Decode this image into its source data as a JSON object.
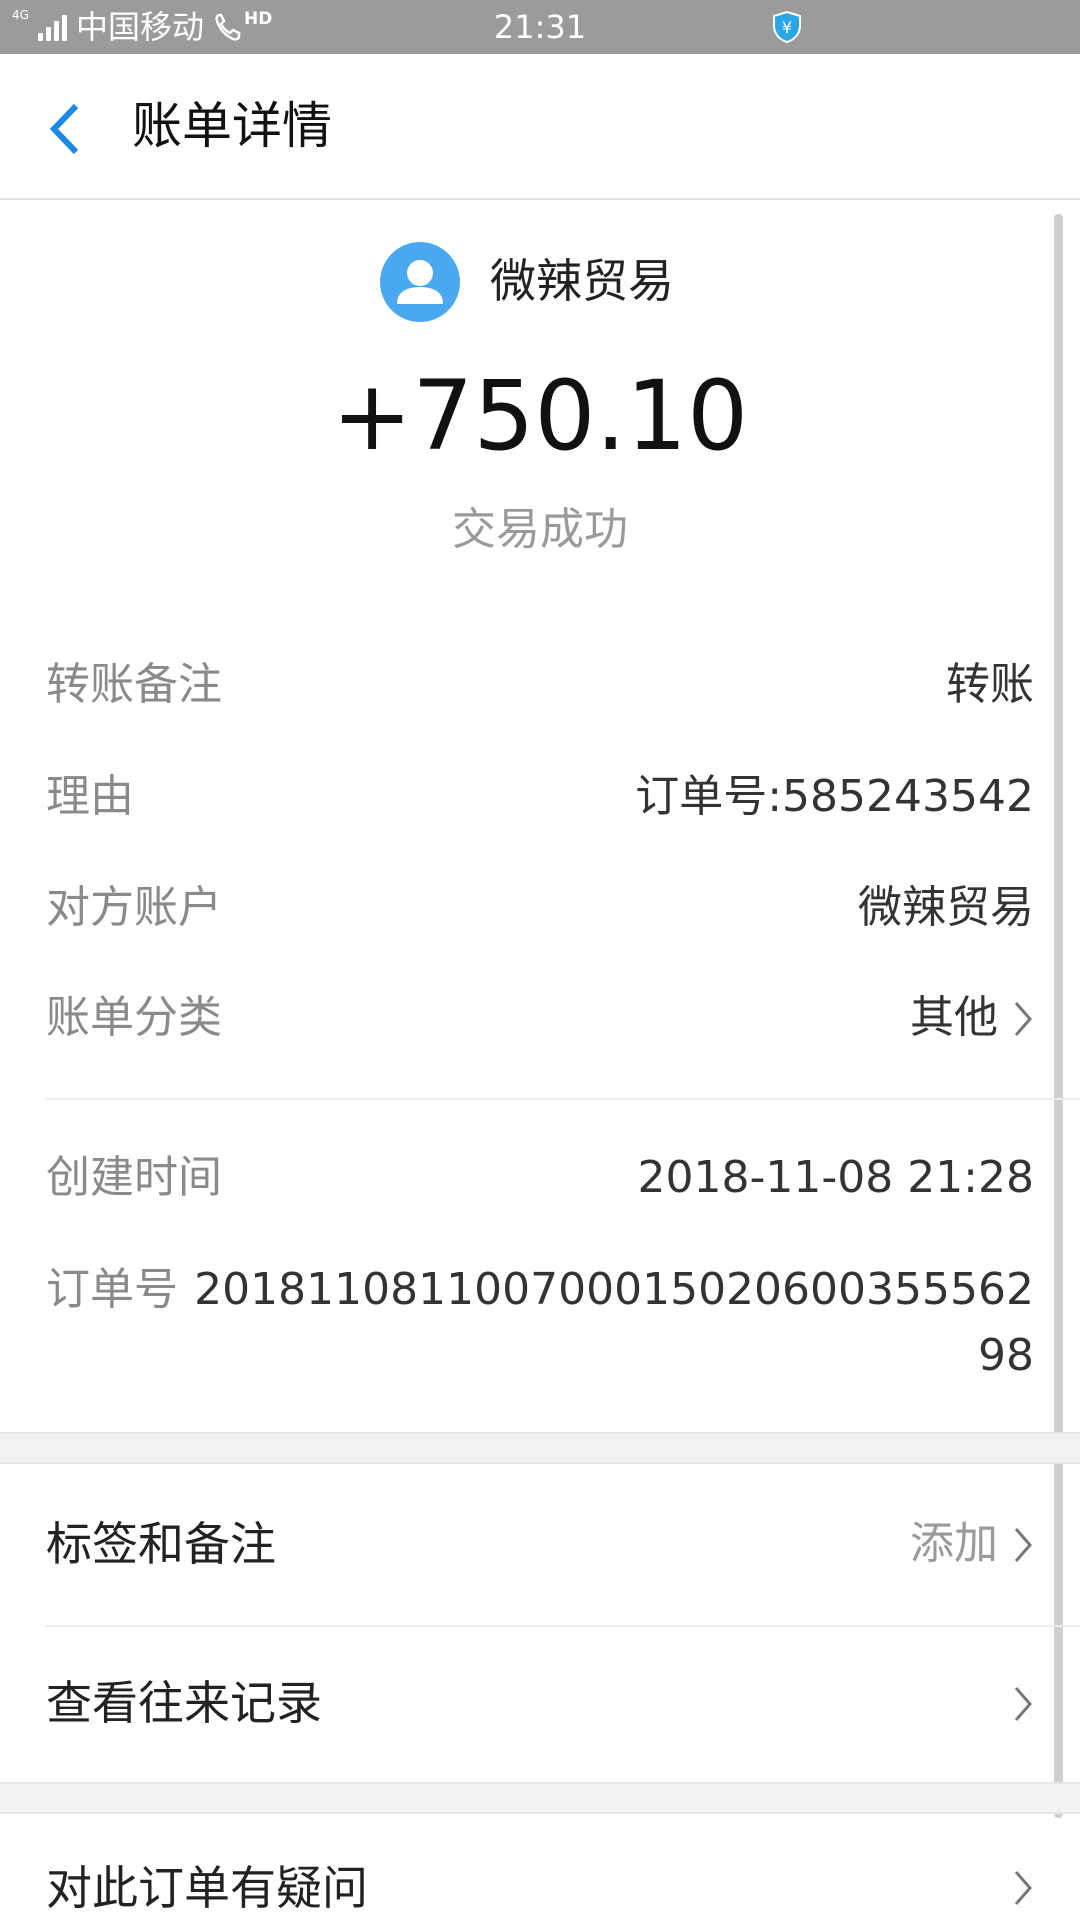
{
  "status_bar": {
    "network": "4G",
    "carrier": "中国移动",
    "call_badge": "HD",
    "time": "21:31",
    "shield_symbol": "¥"
  },
  "header": {
    "title": "账单详情",
    "back_icon": "chevron-left-icon"
  },
  "merchant": {
    "name": "微辣贸易",
    "avatar_icon": "person-avatar-icon",
    "avatar_color": "#4aa8f0"
  },
  "amount": "+750.10",
  "status": "交易成功",
  "details": [
    {
      "label": "转账备注",
      "value": "转账"
    },
    {
      "label": "理由",
      "value": "订单号:585243542"
    },
    {
      "label": "对方账户",
      "value": "微辣贸易"
    },
    {
      "label": "账单分类",
      "value": "其他"
    }
  ],
  "meta": [
    {
      "label": "创建时间",
      "value": "2018-11-08 21:28"
    },
    {
      "label": "订单号",
      "value_line1": "201811081100700015020600355562",
      "value_line2": "98"
    }
  ],
  "actions": [
    {
      "label": "标签和备注",
      "value": "添加"
    },
    {
      "label": "查看往来记录"
    },
    {
      "label": "对此订单有疑问"
    }
  ],
  "colors": {
    "accent": "#1e88e5",
    "status_bar": "#9b9b9b",
    "shield": "#2aa6e6"
  }
}
